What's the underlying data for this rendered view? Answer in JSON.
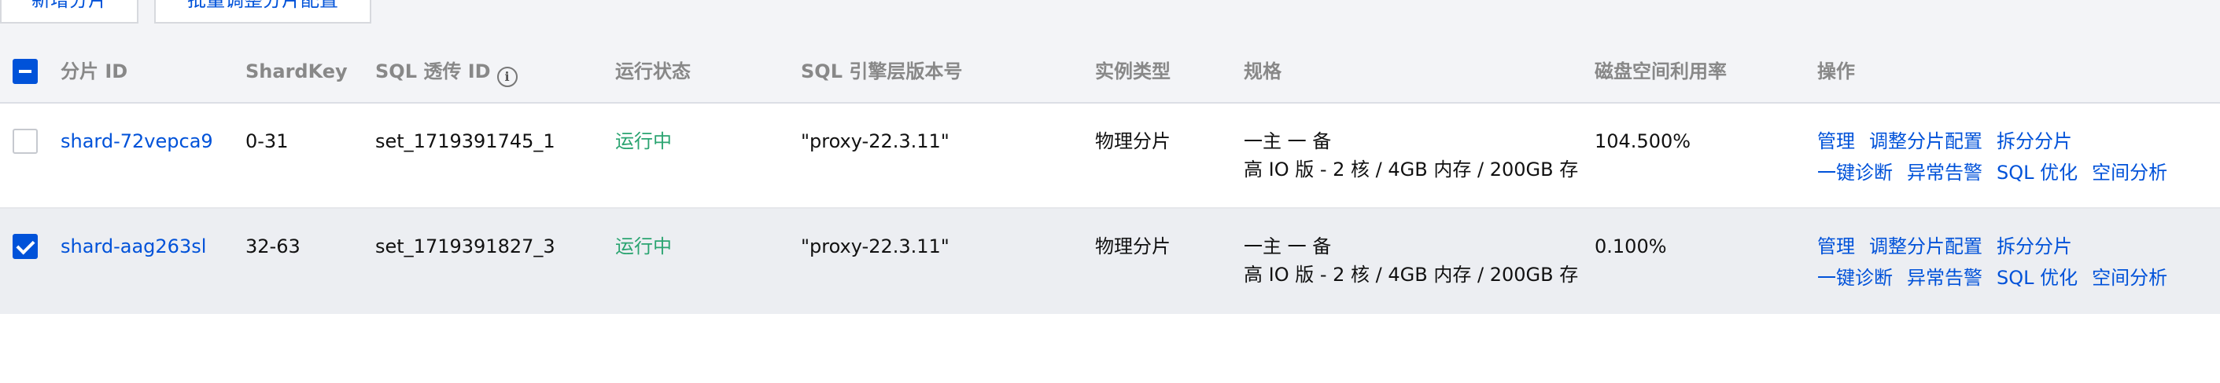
{
  "toolbar": {
    "add_shard_label": "新增分片",
    "batch_adjust_label": "批量调整分片配置"
  },
  "table": {
    "headers": {
      "shard_id": "分片 ID",
      "shardkey": "ShardKey",
      "sql_id": "SQL 透传 ID",
      "status": "运行状态",
      "sql_engine_version": "SQL 引擎层版本号",
      "instance_type": "实例类型",
      "spec": "规格",
      "disk_usage": "磁盘空间利用率",
      "actions": "操作"
    },
    "rows": [
      {
        "checked": false,
        "shard_id": "shard-72vepca9",
        "shardkey": "0-31",
        "sql_id": "set_1719391745_1",
        "status": "运行中",
        "sql_engine_version": "\"proxy-22.3.11\"",
        "instance_type": "物理分片",
        "spec_line1": "一主 一 备",
        "spec_line2": "高 IO 版 - 2 核 / 4GB 内存 / 200GB 存",
        "disk_usage": "104.500%",
        "actions_row1": [
          "管理",
          "调整分片配置",
          "拆分分片"
        ],
        "actions_row2": [
          "一键诊断",
          "异常告警",
          "SQL 优化",
          "空间分析"
        ]
      },
      {
        "checked": true,
        "shard_id": "shard-aag263sl",
        "shardkey": "32-63",
        "sql_id": "set_1719391827_3",
        "status": "运行中",
        "sql_engine_version": "\"proxy-22.3.11\"",
        "instance_type": "物理分片",
        "spec_line1": "一主 一 备",
        "spec_line2": "高 IO 版 - 2 核 / 4GB 内存 / 200GB 存",
        "disk_usage": "0.100%",
        "actions_row1": [
          "管理",
          "调整分片配置",
          "拆分分片"
        ],
        "actions_row2": [
          "一键诊断",
          "异常告警",
          "SQL 优化",
          "空间分析"
        ]
      }
    ]
  },
  "colors": {
    "primary": "#0052d9",
    "status_running": "#2ba471",
    "header_text": "#888888"
  }
}
